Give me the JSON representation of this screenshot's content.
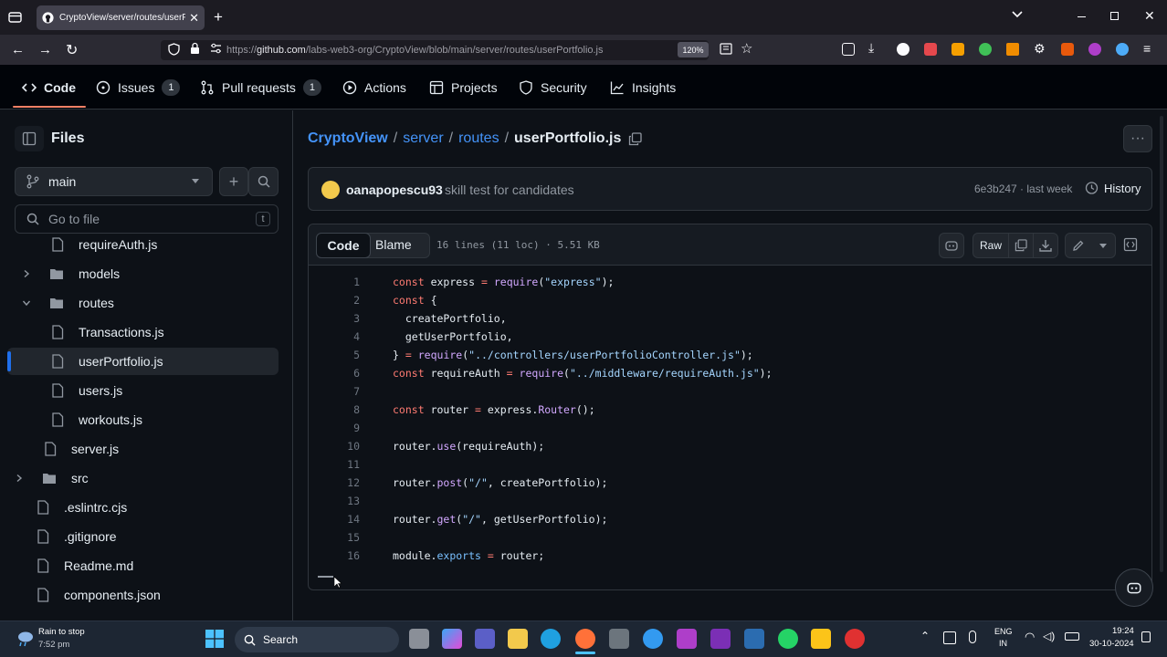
{
  "browser": {
    "tab_title": "CryptoView/server/routes/userP",
    "url_prefix": "https://",
    "url_host": "github.com",
    "url_path": "/labs-web3-org/CryptoView/blob/main/server/routes/userPortfolio.js",
    "zoom": "120%",
    "colors": {
      "chrome": "#1c1b22",
      "toolbar": "#2b2a33"
    }
  },
  "repo_nav": {
    "items": [
      {
        "label": "Code",
        "icon": "code-icon"
      },
      {
        "label": "Issues",
        "icon": "issue-icon",
        "count": "1"
      },
      {
        "label": "Pull requests",
        "icon": "pull-request-icon",
        "count": "1"
      },
      {
        "label": "Actions",
        "icon": "play-icon"
      },
      {
        "label": "Projects",
        "icon": "table-icon"
      },
      {
        "label": "Security",
        "icon": "shield-icon"
      },
      {
        "label": "Insights",
        "icon": "graph-icon"
      }
    ]
  },
  "sidebar": {
    "title": "Files",
    "branch": "main",
    "search_placeholder": "Go to file",
    "search_shortcut": "t",
    "tree": [
      {
        "label": "requireAuth.js",
        "type": "file",
        "depth": 2
      },
      {
        "label": "models",
        "type": "folder",
        "depth": 1,
        "expanded": false
      },
      {
        "label": "routes",
        "type": "folder",
        "depth": 1,
        "expanded": true
      },
      {
        "label": "Transactions.js",
        "type": "file",
        "depth": 2
      },
      {
        "label": "userPortfolio.js",
        "type": "file",
        "depth": 2,
        "selected": true
      },
      {
        "label": "users.js",
        "type": "file",
        "depth": 2
      },
      {
        "label": "workouts.js",
        "type": "file",
        "depth": 2
      },
      {
        "label": "server.js",
        "type": "file",
        "depth": 1
      },
      {
        "label": "src",
        "type": "folder",
        "depth": 0,
        "expanded": false
      },
      {
        "label": ".eslintrc.cjs",
        "type": "file",
        "depth": 0
      },
      {
        "label": ".gitignore",
        "type": "file",
        "depth": 0
      },
      {
        "label": "Readme.md",
        "type": "file",
        "depth": 0
      },
      {
        "label": "components.json",
        "type": "file",
        "depth": 0
      }
    ]
  },
  "breadcrumb": {
    "repo": "CryptoView",
    "sep": "/",
    "dir1": "server",
    "dir2": "routes",
    "file": "userPortfolio.js"
  },
  "commit": {
    "author": "oanapopescu93",
    "message": "skill test for candidates",
    "hash_time": "6e3b247 · last week",
    "history_label": "History"
  },
  "file_header": {
    "tab_code": "Code",
    "tab_blame": "Blame",
    "meta": "16 lines (11 loc) · 5.51 KB",
    "raw_label": "Raw"
  },
  "code": {
    "lines": [
      "1",
      "2",
      "3",
      "4",
      "5",
      "6",
      "7",
      "8",
      "9",
      "10",
      "11",
      "12",
      "13",
      "14",
      "15",
      "16"
    ]
  },
  "taskbar": {
    "weather_line1": "Rain to stop",
    "weather_line2": "7:52 pm",
    "search_label": "Search",
    "lang1": "ENG",
    "lang2": "IN",
    "time": "19:24",
    "date": "30-10-2024"
  },
  "colors": {
    "bg": "#0d1117",
    "border": "#30363d",
    "link": "#4493f8",
    "accent_underline": "#f78166",
    "selected_bar": "#1f6feb"
  }
}
